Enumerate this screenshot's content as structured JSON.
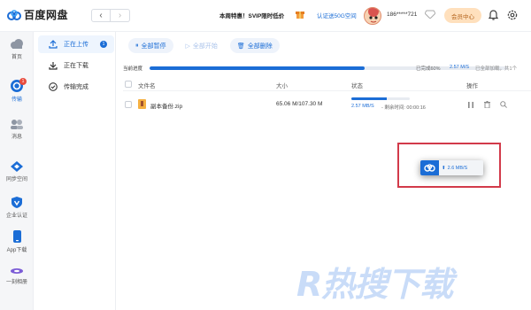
{
  "app": {
    "name": "百度网盘"
  },
  "topbar": {
    "promo_text": "本周特惠！SVIP限时低价",
    "space_link": "认证送50G空间",
    "phone": "186*****721",
    "vip_button": "会员中心"
  },
  "leftnav": {
    "items": [
      {
        "label": "首页",
        "icon": "home-icon"
      },
      {
        "label": "传输",
        "icon": "transfer-icon",
        "badge": "1"
      },
      {
        "label": "消息",
        "icon": "message-icon"
      },
      {
        "label": "同步空间",
        "icon": "sync-icon"
      },
      {
        "label": "企业认证",
        "icon": "enterprise-icon"
      },
      {
        "label": "App下载",
        "icon": "phone-icon"
      },
      {
        "label": "一刻相册",
        "icon": "album-icon"
      }
    ]
  },
  "subnav": {
    "items": [
      {
        "label": "正在上传",
        "badge": "1"
      },
      {
        "label": "正在下载"
      },
      {
        "label": "传输完成"
      }
    ]
  },
  "toolbar": {
    "pause_all": "全部暂停",
    "start_all": "全部开始",
    "delete_all": "全部删除"
  },
  "progress": {
    "label": "当前进度",
    "fraction": 0.6,
    "done_text": "已完成60%",
    "speed": "2.57 M/S",
    "added_text": "已全部加载，共1个"
  },
  "table": {
    "headers": {
      "name": "文件名",
      "size": "大小",
      "status": "状态",
      "actions": "操作"
    },
    "rows": [
      {
        "name": "副本备份.zip",
        "size": "65.06 M/107.30 M",
        "speed": "2.57 MB/S",
        "remaining": "- 剩余时间: 00:00:16",
        "progress": 0.6
      }
    ]
  },
  "float_window": {
    "speed": "2.6 MB/S"
  },
  "watermark": "R热搜下载",
  "colors": {
    "accent": "#1b6dd6",
    "highlight_border": "#d23a4a"
  }
}
